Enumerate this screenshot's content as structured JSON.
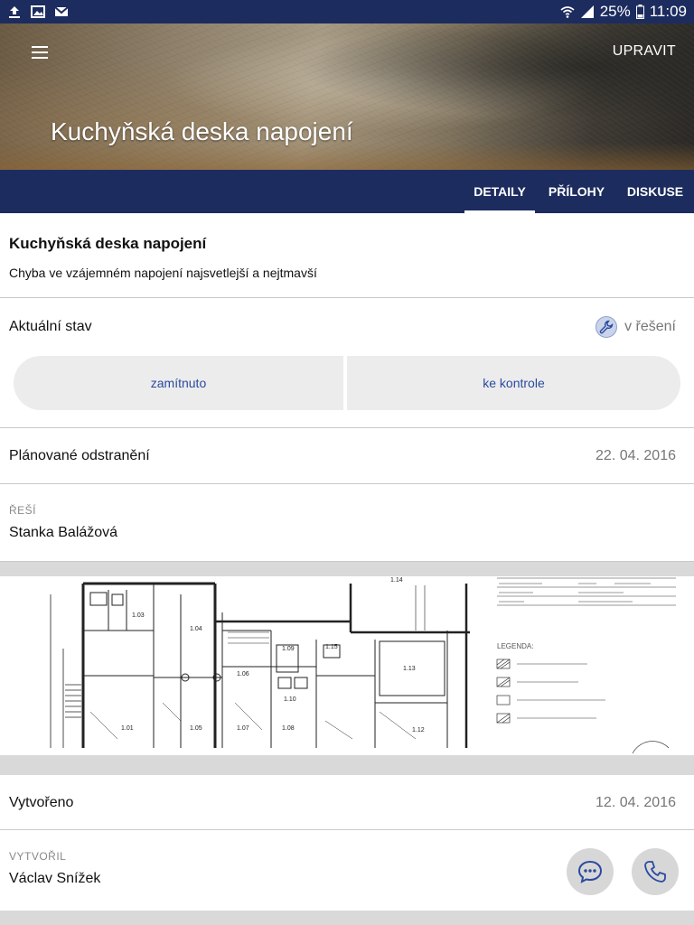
{
  "statusbar": {
    "battery": "25%",
    "time": "11:09"
  },
  "header": {
    "edit_label": "UPRAVIT",
    "title": "Kuchyňská deska napojení"
  },
  "tabs": [
    {
      "label": "DETAILY",
      "active": true
    },
    {
      "label": "PŘÍLOHY",
      "active": false
    },
    {
      "label": "DISKUSE",
      "active": false
    }
  ],
  "detail": {
    "title": "Kuchyňská deska napojení",
    "description": "Chyba ve vzájemném napojení najsvetlejší a nejtmavší"
  },
  "state": {
    "label": "Aktuální stav",
    "value": "v řešení",
    "buttons": {
      "reject": "zamítnuto",
      "check": "ke kontrole"
    }
  },
  "planned": {
    "label": "Plánované odstranění",
    "date": "22. 04. 2016"
  },
  "resi": {
    "caption": "ŘEŠÍ",
    "name": "Stanka Balážová"
  },
  "created": {
    "label": "Vytvořeno",
    "date": "12. 04. 2016"
  },
  "author": {
    "caption": "VYTVOŘIL",
    "name": "Václav Snížek"
  },
  "colors": {
    "primary": "#1c2c5f",
    "accent_text": "#2a4aa0",
    "divider": "#d9d9d9"
  },
  "icons": [
    "upload-icon",
    "image-icon",
    "gmail-icon",
    "wifi-icon",
    "signal-icon",
    "battery-icon",
    "menu-icon",
    "wrench-icon",
    "chat-icon",
    "phone-icon"
  ],
  "floor_plan": {
    "room_labels": [
      "1.14",
      "1.03",
      "1.04",
      "1.06",
      "1.09",
      "1.10",
      "1.15",
      "1.13",
      "1.01",
      "1.05",
      "1.07",
      "1.08",
      "1.12"
    ],
    "legend_title": "LEGENDA:"
  }
}
